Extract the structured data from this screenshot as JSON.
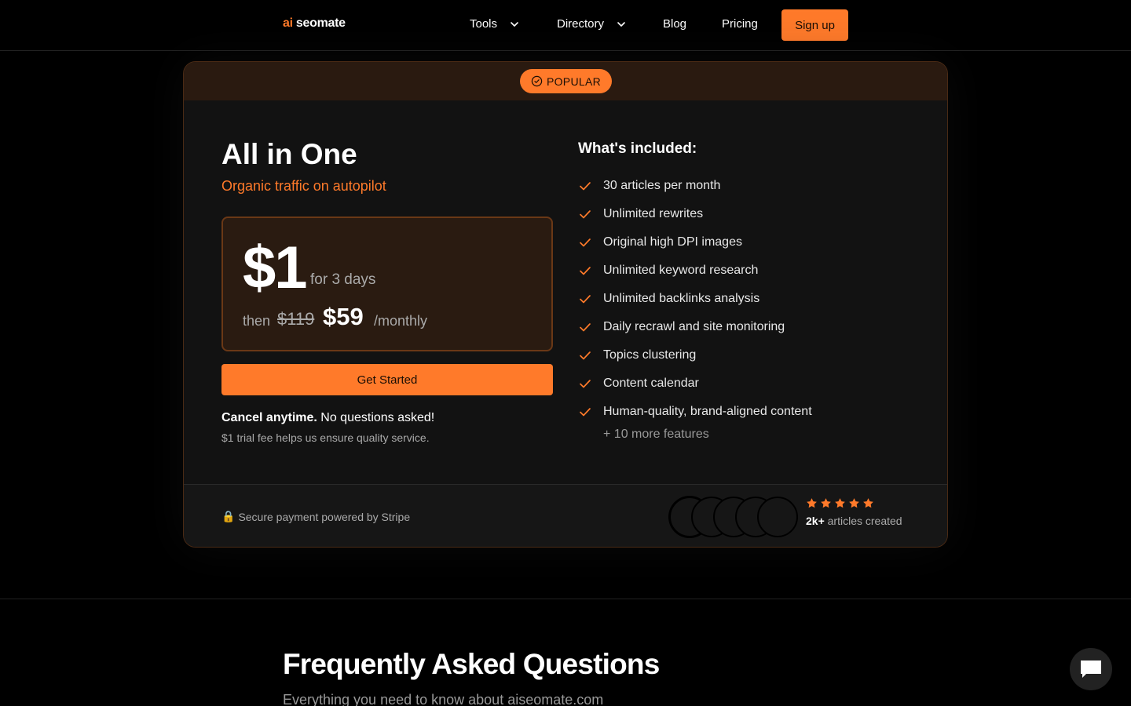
{
  "nav": {
    "logo_ai": "ai",
    "logo_name": "seomate",
    "items": [
      {
        "label": "Tools",
        "has_dropdown": true
      },
      {
        "label": "Directory",
        "has_dropdown": true
      },
      {
        "label": "Blog",
        "has_dropdown": false
      },
      {
        "label": "Pricing",
        "has_dropdown": false
      }
    ],
    "signup_label": "Sign up"
  },
  "plan": {
    "badge": "POPULAR",
    "title": "All in One",
    "subtitle": "Organic traffic on autopilot",
    "trial_price": "$1",
    "trial_period": "for 3 days",
    "then_label": "then",
    "old_price": "$119",
    "new_price": "$59",
    "billing": "/monthly",
    "cta_label": "Get Started",
    "cancel_bold": "Cancel anytime.",
    "cancel_rest": " No questions asked!",
    "trial_note": "$1 trial fee helps us ensure quality service.",
    "included_title": "What's included:",
    "features": [
      "30 articles per month",
      "Unlimited rewrites",
      "Original high DPI images",
      "Unlimited keyword research",
      "Unlimited backlinks analysis",
      "Daily recrawl and site monitoring",
      "Topics clustering",
      "Content calendar",
      "Human-quality, brand-aligned content"
    ],
    "more_features": "+ 10 more features",
    "secure_icon": "🔒",
    "secure_text": "Secure payment powered by Stripe",
    "rating_stars": 5,
    "articles_count": "2k+",
    "articles_label": " articles created"
  },
  "faq": {
    "title": "Frequently Asked Questions",
    "subtitle": "Everything you need to know about aiseomate.com"
  },
  "colors": {
    "accent": "#ff7a2a",
    "background": "#000000",
    "card": "#121212"
  }
}
